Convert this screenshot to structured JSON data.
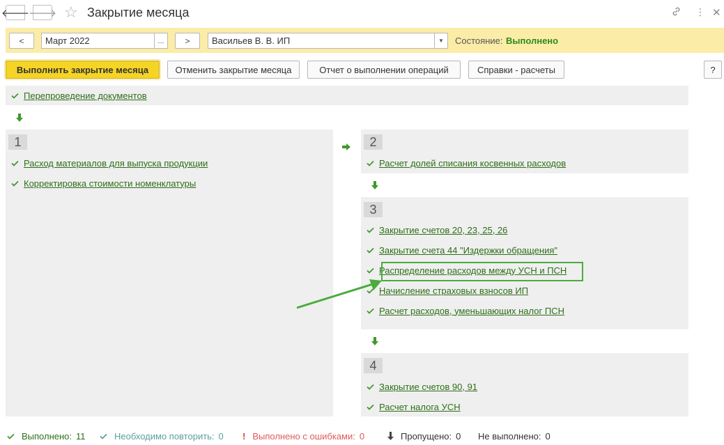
{
  "window": {
    "title": "Закрытие месяца",
    "icons": [
      "back-arrow-icon",
      "forward-arrow-icon",
      "star-icon",
      "link-icon",
      "more-vertical-icon",
      "close-icon"
    ]
  },
  "filter": {
    "prev_label": "<",
    "period_value": "Март 2022",
    "period_picker_label": "...",
    "next_label": ">",
    "organization_value": "Васильев В. В. ИП",
    "state_label": "Состояние:",
    "state_value": "Выполнено"
  },
  "commands": {
    "run_label": "Выполнить закрытие месяца",
    "cancel_label": "Отменить закрытие месяца",
    "report_label": "Отчет о выполнении операций",
    "references_label": "Справки - расчеты",
    "help_label": "?"
  },
  "top_task": {
    "label": "Перепроведение документов"
  },
  "panels": [
    {
      "number": "1",
      "tasks": [
        {
          "label": "Расход материалов для выпуска продукции"
        },
        {
          "label": "Корректировка стоимости номенклатуры"
        }
      ]
    },
    {
      "number": "2",
      "tasks": [
        {
          "label": "Расчет долей списания косвенных расходов"
        }
      ]
    },
    {
      "number": "3",
      "tasks": [
        {
          "label": "Закрытие счетов 20, 23, 25, 26"
        },
        {
          "label": "Закрытие счета 44 \"Издержки обращения\""
        },
        {
          "label": "Распределение расходов между УСН и ПСН"
        },
        {
          "label": "Начисление страховых взносов ИП"
        },
        {
          "label": "Расчет расходов, уменьшающих налог ПСН"
        }
      ]
    },
    {
      "number": "4",
      "tasks": [
        {
          "label": "Закрытие счетов 90, 91"
        },
        {
          "label": "Расчет налога УСН"
        }
      ]
    }
  ],
  "status_bar": {
    "done_label": "Выполнено:",
    "done_count": "11",
    "repeat_label": "Необходимо повторить:",
    "repeat_count": "0",
    "errors_label": "Выполнено с ошибками:",
    "errors_count": "0",
    "skipped_label": "Пропущено:",
    "skipped_count": "0",
    "not_done_label": "Не выполнено:",
    "not_done_count": "0"
  },
  "colors": {
    "accent_green": "#2d6f18",
    "status_ok": "#2b8a1e",
    "primary_button": "#f5d426",
    "filter_bar": "#fbeca7",
    "highlight_frame": "#4aab3e",
    "error_red": "#e04040",
    "repeat_teal": "#5aa0a0"
  }
}
